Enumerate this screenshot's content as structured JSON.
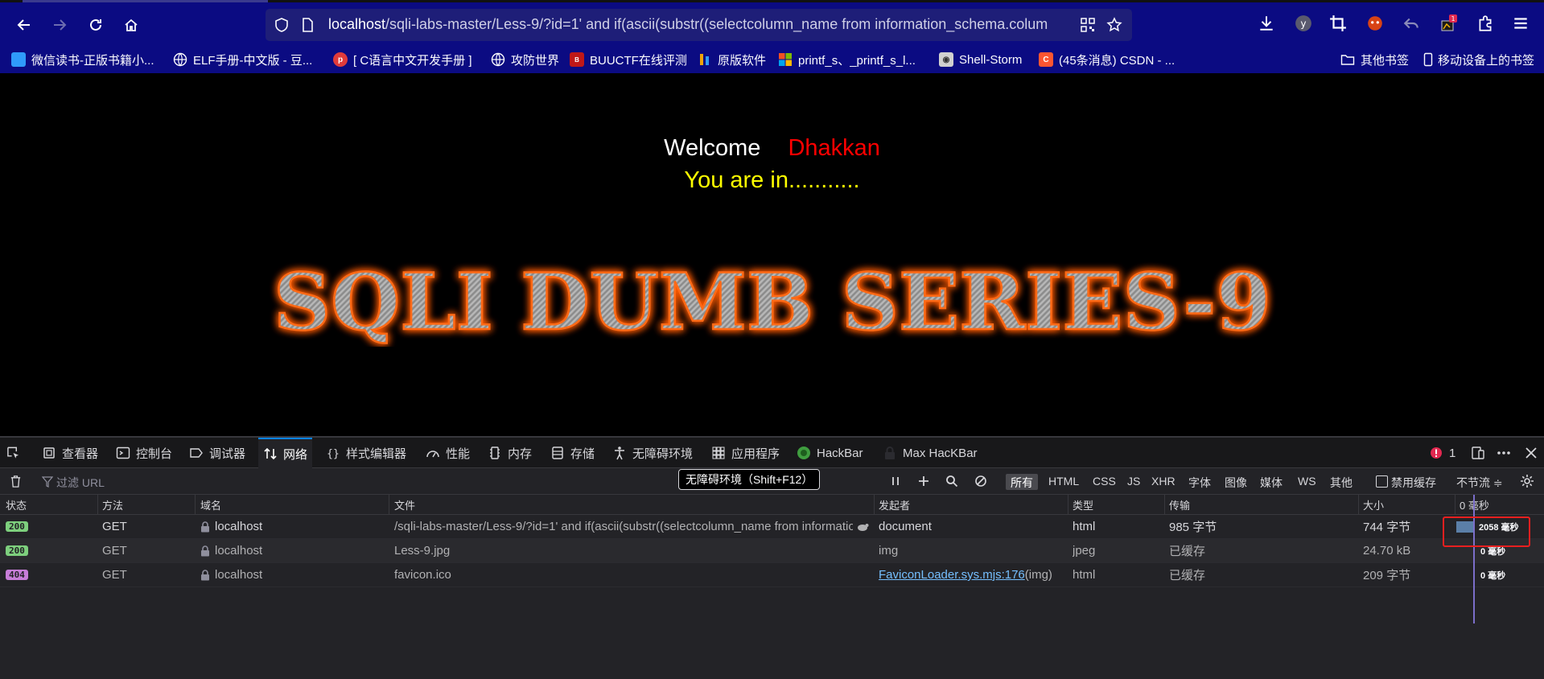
{
  "browser": {
    "url_host": "localhost",
    "url_path": "/sqli-labs-master/Less-9/?id=1' and if(ascii(substr((selectcolumn_name from information_schema.colum",
    "notification_count": "1"
  },
  "bookmarks": [
    {
      "label": "微信读书-正版书籍小...",
      "icon": "weread-icon",
      "color": "#2f9bfb"
    },
    {
      "label": "ELF手册-中文版 - 豆...",
      "icon": "globe-icon",
      "color": "#fbfbfe"
    },
    {
      "label": "[ C语言中文开发手册 ]",
      "icon": "php-icon",
      "color": "#e03b3b"
    },
    {
      "label": "攻防世界",
      "icon": "globe-icon",
      "color": "#fbfbfe"
    },
    {
      "label": "BUUCTF在线评测",
      "icon": "buuctf-icon",
      "color": "#c01818"
    },
    {
      "label": "原版软件",
      "icon": "msdn-icon",
      "color": "#f0a30a"
    },
    {
      "label": "printf_s、_printf_s_l...",
      "icon": "microsoft-icon",
      "color": "#f25022"
    },
    {
      "label": "Shell-Storm",
      "icon": "shellstorm-icon",
      "color": "#d0d0d0"
    },
    {
      "label": "(45条消息) CSDN - ...",
      "icon": "csdn-icon",
      "color": "#fc5531"
    },
    {
      "label": "其他书签",
      "icon": "folder-icon",
      "color": "#fbfbfe"
    },
    {
      "label": "移动设备上的书签",
      "icon": "mobile-icon",
      "color": "#fbfbfe"
    }
  ],
  "page": {
    "welcome": "Welcome",
    "name": "Dhakkan",
    "status": "You are in...........",
    "banner": "SQLI DUMB SERIES-9"
  },
  "devtools": {
    "tabs": [
      {
        "label": "查看器",
        "icon": "inspector-icon"
      },
      {
        "label": "控制台",
        "icon": "console-icon"
      },
      {
        "label": "调试器",
        "icon": "debugger-icon"
      },
      {
        "label": "网络",
        "icon": "network-icon",
        "active": true
      },
      {
        "label": "样式编辑器",
        "icon": "style-editor-icon"
      },
      {
        "label": "性能",
        "icon": "performance-icon"
      },
      {
        "label": "内存",
        "icon": "memory-icon"
      },
      {
        "label": "存储",
        "icon": "storage-icon"
      },
      {
        "label": "无障碍环境",
        "icon": "accessibility-icon"
      },
      {
        "label": "应用程序",
        "icon": "application-icon"
      },
      {
        "label": "HackBar",
        "icon": "hackbar-icon"
      },
      {
        "label": "Max HacKBar",
        "icon": "lock-icon"
      }
    ],
    "error_count": "1",
    "filter_placeholder": "过滤 URL",
    "tooltip": "无障碍环境（Shift+F12）",
    "type_filters": [
      "所有",
      "HTML",
      "CSS",
      "JS",
      "XHR",
      "字体",
      "图像",
      "媒体",
      "WS",
      "其他"
    ],
    "disable_cache": "禁用缓存",
    "throttle": "不节流 ≑",
    "columns": [
      "状态",
      "方法",
      "域名",
      "文件",
      "发起者",
      "类型",
      "传输",
      "大小",
      "0 毫秒"
    ],
    "rows": [
      {
        "status": "200",
        "status_color": "#7dcf7d",
        "method": "GET",
        "domain": "localhost",
        "file": "/sqli-labs-master/Less-9/?id=1' and if(ascii(substr((selectcolumn_name from informatio",
        "initiator": "document",
        "initiator_suffix": "",
        "type": "html",
        "transferred": "985 字节",
        "size": "744 字节",
        "timing": "2058 毫秒",
        "timing_fraction": 0.2
      },
      {
        "status": "200",
        "status_color": "#7dcf7d",
        "method": "GET",
        "domain": "localhost",
        "file": "Less-9.jpg",
        "initiator": "img",
        "initiator_suffix": "",
        "type": "jpeg",
        "transferred": "已缓存",
        "size": "24.70 kB",
        "timing": "0 毫秒",
        "timing_fraction": 0
      },
      {
        "status": "404",
        "status_color": "#c77dd8",
        "method": "GET",
        "domain": "localhost",
        "file": "favicon.ico",
        "initiator": "FaviconLoader.sys.mjs:176",
        "initiator_suffix": " (img)",
        "type": "html",
        "transferred": "已缓存",
        "size": "209 字节",
        "timing": "0 毫秒",
        "timing_fraction": 0
      }
    ]
  }
}
